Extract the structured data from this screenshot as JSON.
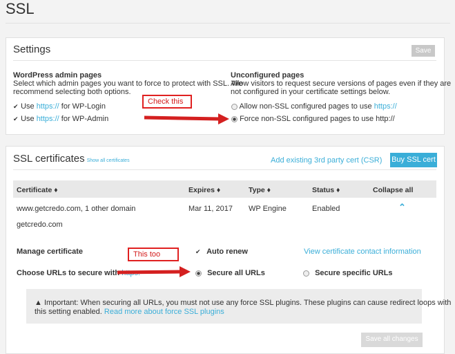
{
  "page": {
    "title": "SSL"
  },
  "settings": {
    "title": "Settings",
    "save_label": "Save",
    "admin": {
      "heading": "WordPress admin pages",
      "desc1": "Select which admin pages you want to force to protect with SSL. We",
      "desc2": "recommend selecting both options.",
      "opt1_pre": "Use ",
      "opt1_link": "https://",
      "opt1_post": " for WP-Login",
      "opt2_pre": "Use ",
      "opt2_link": "https://",
      "opt2_post": " for WP-Admin"
    },
    "unconfigured": {
      "heading": "Unconfigured pages",
      "desc1": "Allow visitors to request secure versions of pages even if they are",
      "desc2": "not configured in your certificate settings below.",
      "opt1_pre": "Allow non-SSL configured pages to use ",
      "opt1_link": "https://",
      "opt2": "Force non-SSL configured pages to use http://"
    },
    "callout": "Check this"
  },
  "ssl": {
    "title": "SSL certificates",
    "show_all": "Show all certificates",
    "add_existing": "Add existing 3rd party cert (CSR)",
    "buy": "Buy SSL cert",
    "columns": {
      "certificate": "Certificate ♦",
      "expires": "Expires ♦",
      "type": "Type ♦",
      "status": "Status ♦",
      "collapse": "Collapse all"
    },
    "row": {
      "certificate": "www.getcredo.com, 1 other domain",
      "expires": "Mar 11, 2017",
      "type": "WP Engine",
      "status": "Enabled",
      "domain2": "getcredo.com"
    },
    "manage_label": "Manage certificate",
    "auto_renew": "Auto renew",
    "view_contact": "View certificate contact information",
    "choose_pre": "Choose URLs to secure with ",
    "choose_link": "https:",
    "secure_all": "Secure all URLs",
    "secure_specific": "Secure specific URLs",
    "callout": "This too",
    "notice1": "Important: When securing all URLs, you must not use any force SSL plugins. These plugins can cause redirect loops with",
    "notice2_pre": "this setting enabled. ",
    "notice2_link": "Read more about force SSL plugins",
    "save_all": "Save all changes"
  },
  "colors": {
    "accent": "#3aaed8",
    "callout": "#e02020"
  }
}
